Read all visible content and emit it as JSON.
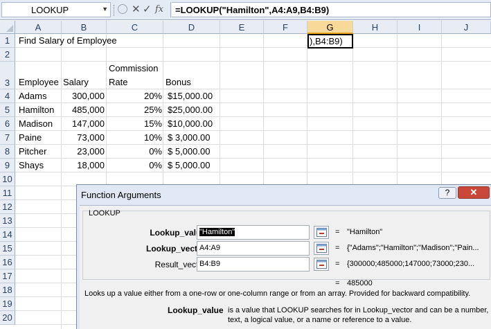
{
  "formula_bar": {
    "name_box": "LOOKUP",
    "formula": "=LOOKUP(\"Hamilton\",A4:A9,B4:B9)",
    "cancel_glyph": "✕",
    "enter_glyph": "✓",
    "fx_glyph": "fx"
  },
  "columns": [
    "A",
    "B",
    "C",
    "D",
    "E",
    "F",
    "G",
    "H",
    "I",
    "J"
  ],
  "rows": [
    "1",
    "2",
    "3",
    "4",
    "5",
    "6",
    "7",
    "8",
    "9",
    "10",
    "11",
    "12",
    "13",
    "14",
    "15",
    "16",
    "17",
    "18",
    "19",
    "20"
  ],
  "sheet": {
    "title": "Find Salary of Employee",
    "g1_edit": "),B4:B9)",
    "headers": {
      "employee": "Employee",
      "salary": "Salary",
      "commission_1": "Commission",
      "commission_2": "Rate",
      "bonus": "Bonus"
    },
    "data": [
      {
        "employee": "Adams",
        "salary": "300,000",
        "rate": "20%",
        "bonus": "$15,000.00"
      },
      {
        "employee": "Hamilton",
        "salary": "485,000",
        "rate": "25%",
        "bonus": "$25,000.00"
      },
      {
        "employee": "Madison",
        "salary": "147,000",
        "rate": "15%",
        "bonus": "$10,000.00"
      },
      {
        "employee": "Paine",
        "salary": "73,000",
        "rate": "10%",
        "bonus": "$  3,000.00"
      },
      {
        "employee": "Pitcher",
        "salary": "23,000",
        "rate": "0%",
        "bonus": "$  5,000.00"
      },
      {
        "employee": "Shays",
        "salary": "18,000",
        "rate": "0%",
        "bonus": "$  5,000.00"
      }
    ]
  },
  "dialog": {
    "title": "Function Arguments",
    "help": "?",
    "close": "✕",
    "function_name": "LOOKUP",
    "args": [
      {
        "label": "Lookup_value",
        "value": "\"Hamilton\"",
        "result": "\"Hamilton\""
      },
      {
        "label": "Lookup_vector",
        "value": "A4:A9",
        "result": "{\"Adams\";\"Hamilton\";\"Madison\";\"Pain..."
      },
      {
        "label": "Result_vector",
        "value": "B4:B9",
        "result": "{300000;485000;147000;73000;230..."
      }
    ],
    "equals": "=",
    "result": "485000",
    "description": "Looks up a value either from a one-row or one-column range or from an array. Provided for backward compatibility.",
    "arg_help_label": "Lookup_value",
    "arg_help_line1": "is a value that LOOKUP searches for in Lookup_vector and can be a number,",
    "arg_help_line2": "text, a logical value, or a name or reference to a value."
  }
}
